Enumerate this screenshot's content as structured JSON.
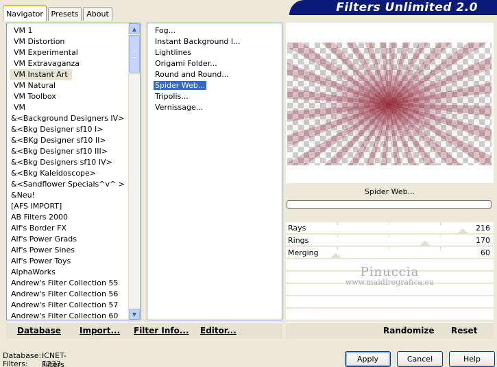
{
  "tabs": [
    "Navigator",
    "Presets",
    "About"
  ],
  "banner_title": "Filters Unlimited 2.0",
  "categories": [
    "VM 1",
    "VM Distortion",
    "VM Experimental",
    "VM Extravaganza",
    "VM Instant Art",
    "VM Natural",
    "VM Toolbox",
    "VM",
    "&<Background Designers IV>",
    "&<Bkg Designer sf10 I>",
    "&<BKg Designer sf10 II>",
    "&<Bkg Designer sf10 III>",
    "&<Bkg Designers sf10 IV>",
    "&<Bkg Kaleidoscope>",
    "&<Sandflower Specials^v^ >",
    "&Neu!",
    "[AFS IMPORT]",
    "AB Filters 2000",
    "Alf's Border FX",
    "Alf's Power Grads",
    "Alf's Power Sines",
    "Alf's Power Toys",
    "AlphaWorks",
    "Andrew's Filter Collection 55",
    "Andrew's Filter Collection 56",
    "Andrew's Filter Collection 57",
    "Andrew's Filter Collection 60"
  ],
  "selected_category": "VM Instant Art",
  "filters": [
    "Fog...",
    "Instant Background I...",
    "Lightlines",
    "Origami Folder...",
    "Round and Round...",
    "Spider Web...",
    "Tripolis...",
    "Vernissage..."
  ],
  "selected_filter": "Spider Web...",
  "preview_filter_name": "Spider Web...",
  "params": [
    {
      "label": "Rays",
      "value": "216",
      "level": 0.85
    },
    {
      "label": "Rings",
      "value": "170",
      "level": 0.67
    },
    {
      "label": "Merging",
      "value": "60",
      "level": 0.24
    }
  ],
  "watermark": {
    "line1": "Pinuccia",
    "line2": "www.maidiregrafica.eu"
  },
  "left_links": {
    "database": "Database",
    "import": "Import...",
    "filter_info": "Filter Info...",
    "editor": "Editor..."
  },
  "right_links": {
    "randomize": "Randomize",
    "reset": "Reset"
  },
  "status": {
    "database_label": "Database:",
    "database_value": "ICNET-Filters",
    "filters_label": "Filters:",
    "filters_value": "1233"
  },
  "buttons": {
    "apply": "Apply",
    "cancel": "Cancel",
    "help": "Help"
  },
  "colors": {
    "title_banner": "#0a1a7a",
    "selection": "#316ac5",
    "preview_tint": "#96142a"
  }
}
